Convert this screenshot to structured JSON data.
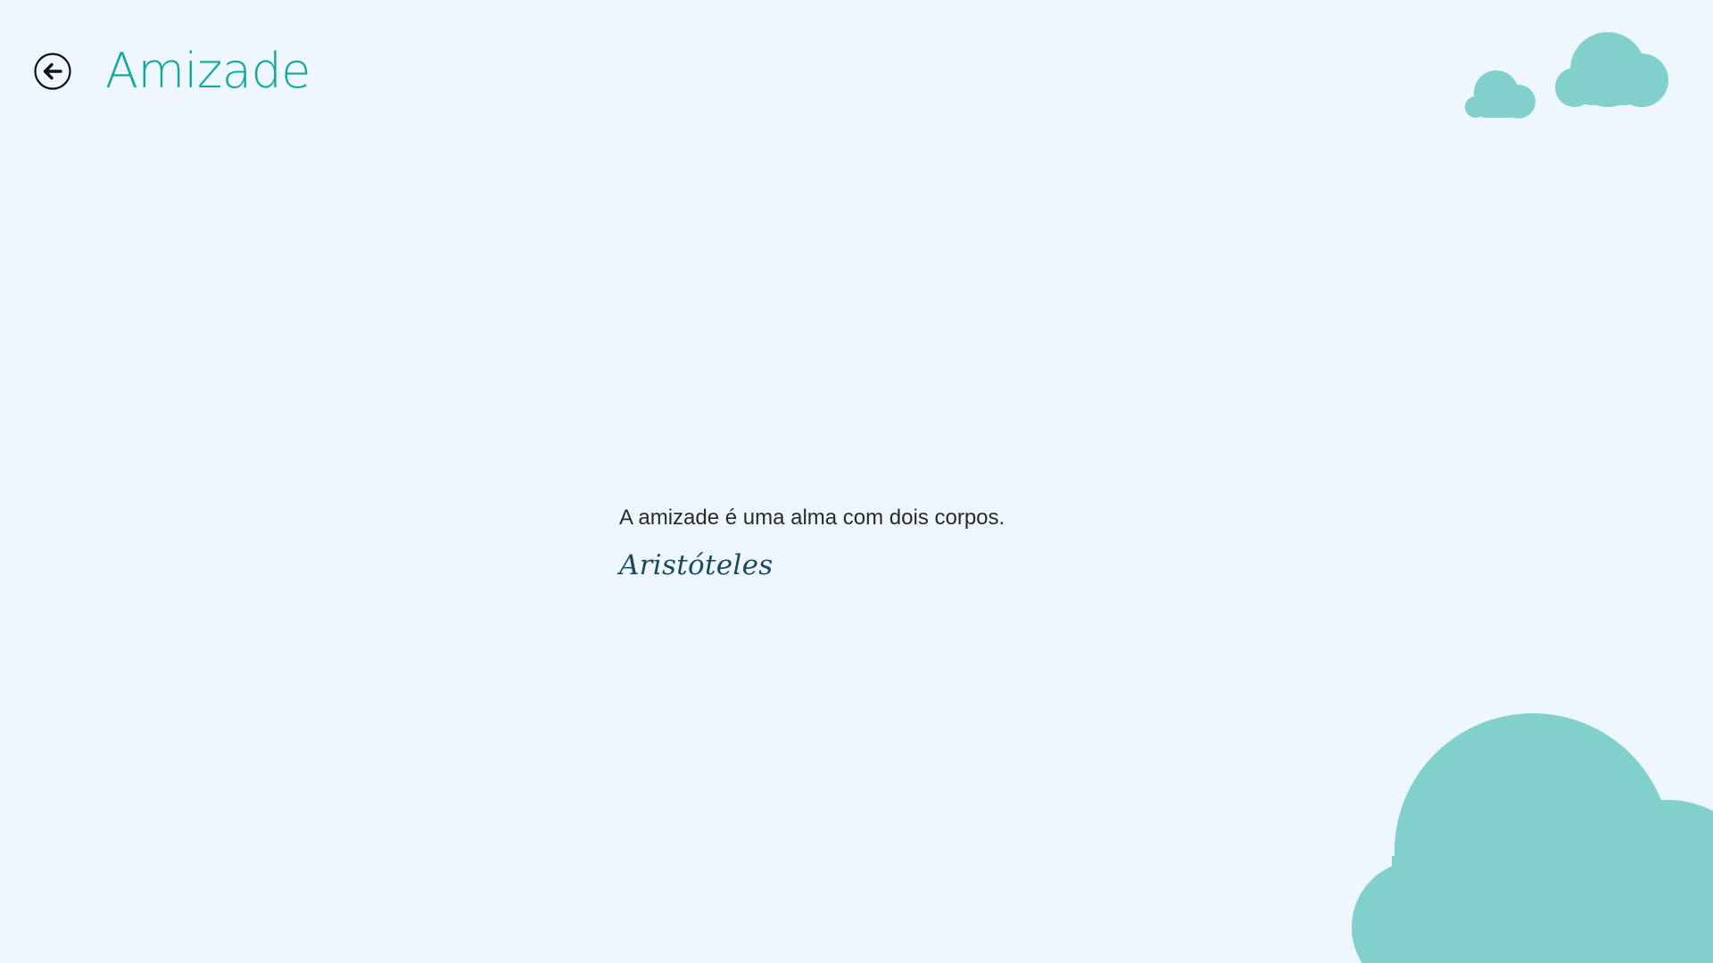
{
  "header": {
    "back_label": "Voltar",
    "title": "Amizade"
  },
  "quote": {
    "text": "A amizade é uma alma com dois corpos.",
    "author": "Aristóteles"
  },
  "icons": {
    "back": "back-arrow-circle-icon",
    "decor": "cloud-icon"
  },
  "colors": {
    "background": "#eef7fe",
    "accent": "#14a79c",
    "cloud": "#82d0cc",
    "text": "#2a2a2a",
    "author": "#1b4a5e"
  }
}
